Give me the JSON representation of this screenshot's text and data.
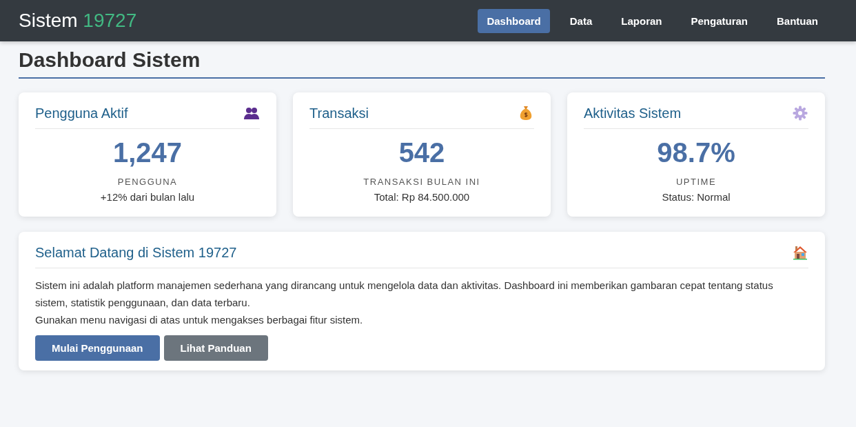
{
  "navbar": {
    "brand": "Sistem",
    "brand_number": "19727",
    "items": [
      {
        "label": "Dashboard",
        "selected": true
      },
      {
        "label": "Data",
        "selected": false
      },
      {
        "label": "Laporan",
        "selected": false
      },
      {
        "label": "Pengaturan",
        "selected": false
      },
      {
        "label": "Bantuan",
        "selected": false
      }
    ]
  },
  "page_title": "Dashboard Sistem",
  "stats": [
    {
      "title": "Pengguna Aktif",
      "kind": "users",
      "value": "1,247",
      "label": "PENGGUNA",
      "note": "+12% dari bulan lalu"
    },
    {
      "title": "Transaksi",
      "kind": "money",
      "value": "542",
      "label": "TRANSAKSI BULAN INI",
      "note": "Total: Rp 84.500.000"
    },
    {
      "title": "Aktivitas Sistem",
      "kind": "gear",
      "value": "98.7%",
      "label": "UPTIME",
      "note": "Status: Normal"
    }
  ],
  "welcome": {
    "title": "Selamat Datang di Sistem 19727",
    "paragraphs": [
      "Sistem ini adalah platform manajemen sederhana yang dirancang untuk mengelola data dan aktivitas. Dashboard ini memberikan gambaran cepat tentang status sistem, statistik penggunaan, dan data terbaru.",
      "Gunakan menu navigasi di atas untuk mengakses berbagai fitur sistem."
    ],
    "buttons": [
      {
        "label": "Mulai Penggunaan",
        "kind": "primary"
      },
      {
        "label": "Lihat Panduan",
        "kind": "secondary"
      }
    ]
  }
}
